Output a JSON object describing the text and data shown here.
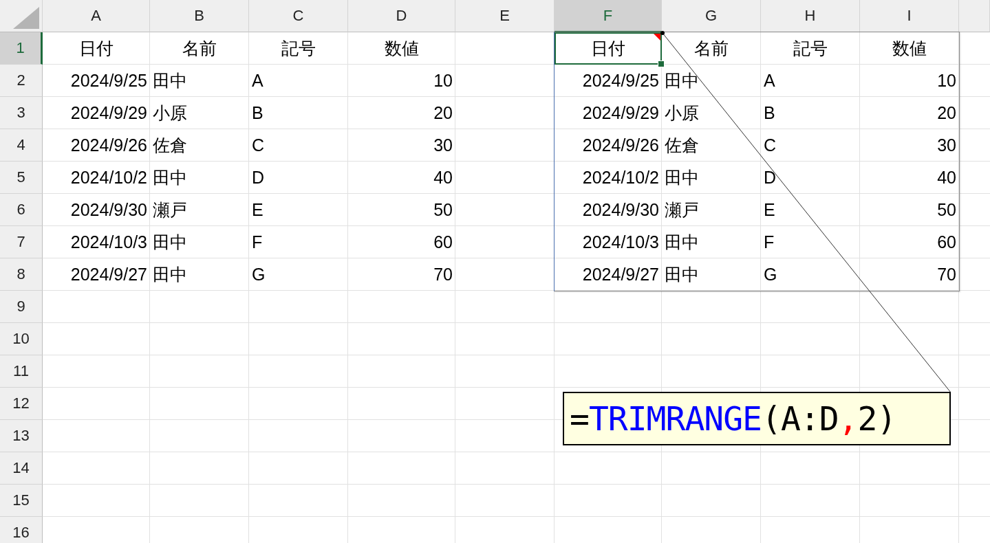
{
  "columns": [
    {
      "label": "A",
      "selected": false
    },
    {
      "label": "B",
      "selected": false
    },
    {
      "label": "C",
      "selected": false
    },
    {
      "label": "D",
      "selected": false
    },
    {
      "label": "E",
      "selected": false
    },
    {
      "label": "F",
      "selected": true
    },
    {
      "label": "G",
      "selected": false
    },
    {
      "label": "H",
      "selected": false
    },
    {
      "label": "I",
      "selected": false
    }
  ],
  "rows": [
    {
      "label": "1",
      "selected": true
    },
    {
      "label": "2",
      "selected": false
    },
    {
      "label": "3",
      "selected": false
    },
    {
      "label": "4",
      "selected": false
    },
    {
      "label": "5",
      "selected": false
    },
    {
      "label": "6",
      "selected": false
    },
    {
      "label": "7",
      "selected": false
    },
    {
      "label": "8",
      "selected": false
    },
    {
      "label": "9",
      "selected": false
    },
    {
      "label": "10",
      "selected": false
    },
    {
      "label": "11",
      "selected": false
    },
    {
      "label": "12",
      "selected": false
    },
    {
      "label": "13",
      "selected": false
    },
    {
      "label": "14",
      "selected": false
    },
    {
      "label": "15",
      "selected": false
    },
    {
      "label": "16",
      "selected": false
    }
  ],
  "source_table": {
    "header": [
      "日付",
      "名前",
      "記号",
      "数値"
    ],
    "rows": [
      [
        "2024/9/25",
        "田中",
        "A",
        "10"
      ],
      [
        "2024/9/29",
        "小原",
        "B",
        "20"
      ],
      [
        "2024/9/26",
        "佐倉",
        "C",
        "30"
      ],
      [
        "2024/10/2",
        "田中",
        "D",
        "40"
      ],
      [
        "2024/9/30",
        "瀬戸",
        "E",
        "50"
      ],
      [
        "2024/10/3",
        "田中",
        "F",
        "60"
      ],
      [
        "2024/9/27",
        "田中",
        "G",
        "70"
      ]
    ]
  },
  "spill_table": {
    "has_note": true,
    "header": [
      "日付",
      "名前",
      "記号",
      "数値"
    ],
    "rows": [
      [
        "2024/9/25",
        "田中",
        "A",
        "10"
      ],
      [
        "2024/9/29",
        "小原",
        "B",
        "20"
      ],
      [
        "2024/9/26",
        "佐倉",
        "C",
        "30"
      ],
      [
        "2024/10/2",
        "田中",
        "D",
        "40"
      ],
      [
        "2024/9/30",
        "瀬戸",
        "E",
        "50"
      ],
      [
        "2024/10/3",
        "田中",
        "F",
        "60"
      ],
      [
        "2024/9/27",
        "田中",
        "G",
        "70"
      ]
    ]
  },
  "callout": {
    "parts": [
      {
        "text": "=",
        "color": "#000000"
      },
      {
        "text": "TRIMRANGE",
        "color": "#0000ff"
      },
      {
        "text": "(A:D",
        "color": "#000000"
      },
      {
        "text": ",",
        "color": "#ff0000"
      },
      {
        "text": "2)",
        "color": "#000000"
      }
    ]
  }
}
